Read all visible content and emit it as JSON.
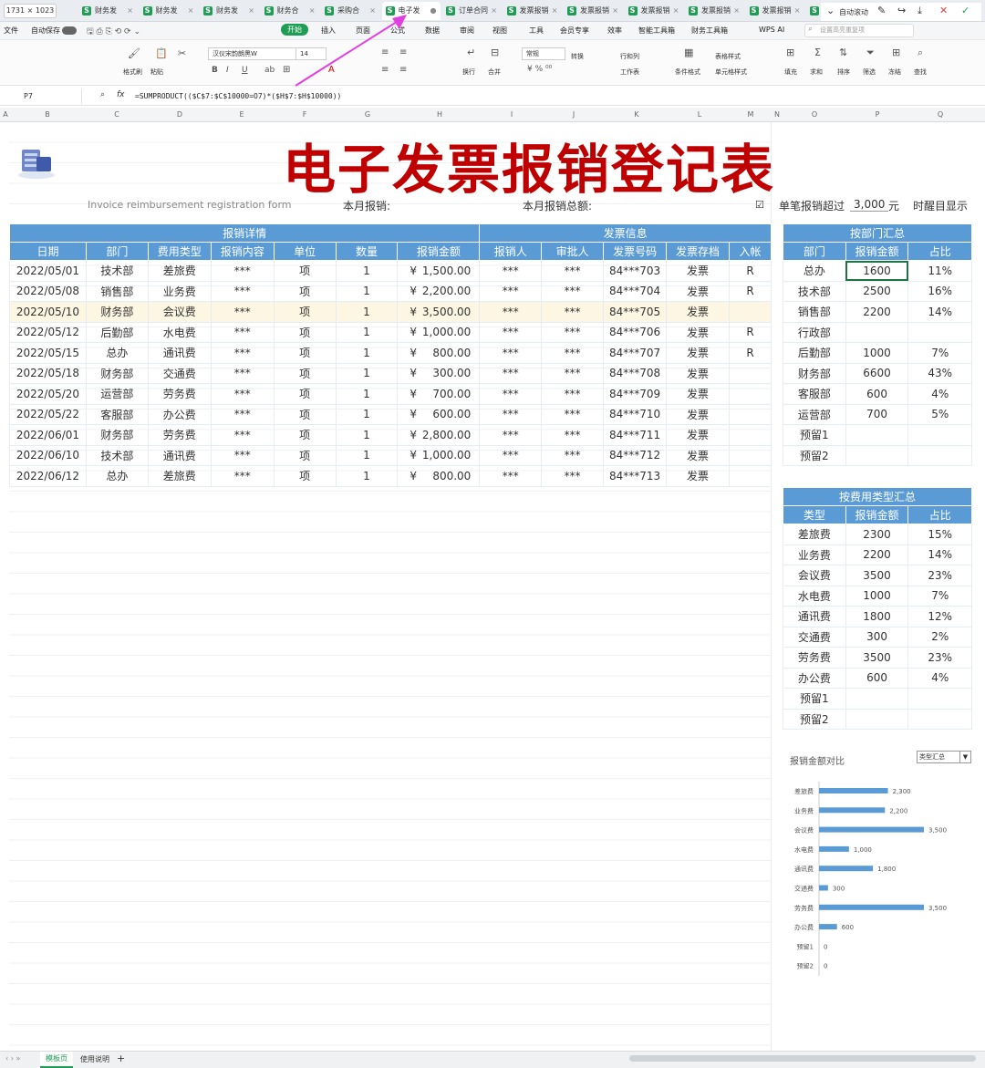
{
  "window": {
    "dimensions": "1731 × 1023",
    "auto_scroll": "自动滚动"
  },
  "tabs": [
    {
      "label": "财务发",
      "active": false
    },
    {
      "label": "财务发",
      "active": false
    },
    {
      "label": "财务发",
      "active": false
    },
    {
      "label": "财务合",
      "active": false
    },
    {
      "label": "采购合",
      "active": false
    },
    {
      "label": "电子发",
      "active": true
    },
    {
      "label": "订单合同",
      "active": false
    },
    {
      "label": "发票报销",
      "active": false
    },
    {
      "label": "发票报销",
      "active": false
    },
    {
      "label": "发票报销",
      "active": false
    },
    {
      "label": "发票报销",
      "active": false
    },
    {
      "label": "发票报销",
      "active": false
    },
    {
      "label": "2",
      "active": false
    }
  ],
  "menu": {
    "file": "文件",
    "autosave": "自动保存",
    "items": [
      "开始",
      "插入",
      "页面",
      "公式",
      "数据",
      "审阅",
      "视图",
      "工具",
      "会员专享",
      "效率",
      "智能工具箱",
      "财务工具箱",
      "WPS AI"
    ],
    "search_placeholder": "设置高亮重复项"
  },
  "ribbon": {
    "font_name": "汉仪宋韵朗黑W",
    "font_size": "14",
    "number_format": "常规",
    "labels": [
      "格式刷",
      "粘贴",
      "换行",
      "合并",
      "转换",
      "行和列",
      "工作表",
      "条件格式",
      "表格样式",
      "单元格样式",
      "填充",
      "求和",
      "排序",
      "筛选",
      "冻结",
      "查找"
    ]
  },
  "formula_bar": {
    "cell": "P7",
    "fx": "fx",
    "formula": "=SUMPRODUCT(($C$7:$C$10000=O7)*($H$7:$H$10000))"
  },
  "columns": [
    "A",
    "B",
    "C",
    "D",
    "E",
    "F",
    "G",
    "H",
    "I",
    "J",
    "K",
    "L",
    "M",
    "N",
    "O",
    "P",
    "Q"
  ],
  "sheet": {
    "title": "电子发票报销登记表",
    "subtitle_en": "Invoice  reimbursement  registration  form",
    "this_month": "本月报销:",
    "this_month_total": "本月报销总额:",
    "threshold_checkbox": "☑",
    "threshold_label": "单笔报销超过",
    "threshold_value": "3,000",
    "threshold_unit": "元",
    "reminder": "时醒目显示"
  },
  "main_table": {
    "group1": "报销详情",
    "group2": "发票信息",
    "headers": [
      "日期",
      "部门",
      "费用类型",
      "报销内容",
      "单位",
      "数量",
      "报销金额",
      "报销人",
      "审批人",
      "发票号码",
      "发票存档",
      "入帐"
    ],
    "currency": "¥",
    "rows": [
      {
        "date": "2022/05/01",
        "dept": "技术部",
        "type": "差旅费",
        "content": "***",
        "unit": "项",
        "qty": "1",
        "amount": "1,500.00",
        "person": "***",
        "approver": "***",
        "invoice": "84***703",
        "archive": "发票",
        "posted": "R"
      },
      {
        "date": "2022/05/08",
        "dept": "销售部",
        "type": "业务费",
        "content": "***",
        "unit": "项",
        "qty": "1",
        "amount": "2,200.00",
        "person": "***",
        "approver": "***",
        "invoice": "84***704",
        "archive": "发票",
        "posted": "R"
      },
      {
        "date": "2022/05/10",
        "dept": "财务部",
        "type": "会议费",
        "content": "***",
        "unit": "项",
        "qty": "1",
        "amount": "3,500.00",
        "person": "***",
        "approver": "***",
        "invoice": "84***705",
        "archive": "发票",
        "posted": ""
      },
      {
        "date": "2022/05/12",
        "dept": "后勤部",
        "type": "水电费",
        "content": "***",
        "unit": "项",
        "qty": "1",
        "amount": "1,000.00",
        "person": "***",
        "approver": "***",
        "invoice": "84***706",
        "archive": "发票",
        "posted": "R"
      },
      {
        "date": "2022/05/15",
        "dept": "总办",
        "type": "通讯费",
        "content": "***",
        "unit": "项",
        "qty": "1",
        "amount": "800.00",
        "person": "***",
        "approver": "***",
        "invoice": "84***707",
        "archive": "发票",
        "posted": "R"
      },
      {
        "date": "2022/05/18",
        "dept": "财务部",
        "type": "交通费",
        "content": "***",
        "unit": "项",
        "qty": "1",
        "amount": "300.00",
        "person": "***",
        "approver": "***",
        "invoice": "84***708",
        "archive": "发票",
        "posted": ""
      },
      {
        "date": "2022/05/20",
        "dept": "运营部",
        "type": "劳务费",
        "content": "***",
        "unit": "项",
        "qty": "1",
        "amount": "700.00",
        "person": "***",
        "approver": "***",
        "invoice": "84***709",
        "archive": "发票",
        "posted": ""
      },
      {
        "date": "2022/05/22",
        "dept": "客服部",
        "type": "办公费",
        "content": "***",
        "unit": "项",
        "qty": "1",
        "amount": "600.00",
        "person": "***",
        "approver": "***",
        "invoice": "84***710",
        "archive": "发票",
        "posted": ""
      },
      {
        "date": "2022/06/01",
        "dept": "财务部",
        "type": "劳务费",
        "content": "***",
        "unit": "项",
        "qty": "1",
        "amount": "2,800.00",
        "person": "***",
        "approver": "***",
        "invoice": "84***711",
        "archive": "发票",
        "posted": ""
      },
      {
        "date": "2022/06/10",
        "dept": "技术部",
        "type": "通讯费",
        "content": "***",
        "unit": "项",
        "qty": "1",
        "amount": "1,000.00",
        "person": "***",
        "approver": "***",
        "invoice": "84***712",
        "archive": "发票",
        "posted": ""
      },
      {
        "date": "2022/06/12",
        "dept": "总办",
        "type": "差旅费",
        "content": "***",
        "unit": "项",
        "qty": "1",
        "amount": "800.00",
        "person": "***",
        "approver": "***",
        "invoice": "84***713",
        "archive": "发票",
        "posted": ""
      }
    ],
    "highlight_row": 2
  },
  "dept_summary": {
    "title": "按部门汇总",
    "headers": [
      "部门",
      "报销金额",
      "占比"
    ],
    "rows": [
      [
        "总办",
        "1600",
        "11%"
      ],
      [
        "技术部",
        "2500",
        "16%"
      ],
      [
        "销售部",
        "2200",
        "14%"
      ],
      [
        "行政部",
        "",
        ""
      ],
      [
        "后勤部",
        "1000",
        "7%"
      ],
      [
        "财务部",
        "6600",
        "43%"
      ],
      [
        "客服部",
        "600",
        "4%"
      ],
      [
        "运营部",
        "700",
        "5%"
      ],
      [
        "预留1",
        "",
        ""
      ],
      [
        "预留2",
        "",
        ""
      ]
    ]
  },
  "type_summary": {
    "title": "按费用类型汇总",
    "headers": [
      "类型",
      "报销金额",
      "占比"
    ],
    "rows": [
      [
        "差旅费",
        "2300",
        "15%"
      ],
      [
        "业务费",
        "2200",
        "14%"
      ],
      [
        "会议费",
        "3500",
        "23%"
      ],
      [
        "水电费",
        "1000",
        "7%"
      ],
      [
        "通讯费",
        "1800",
        "12%"
      ],
      [
        "交通费",
        "300",
        "2%"
      ],
      [
        "劳务费",
        "3500",
        "23%"
      ],
      [
        "办公费",
        "600",
        "4%"
      ],
      [
        "预留1",
        "",
        ""
      ],
      [
        "预留2",
        "",
        ""
      ]
    ]
  },
  "chart_data": {
    "type": "bar",
    "orientation": "horizontal",
    "title": "报销金额对比",
    "selector": "类型汇总",
    "categories": [
      "差旅费",
      "业务费",
      "会议费",
      "水电费",
      "通讯费",
      "交通费",
      "劳务费",
      "办公费",
      "预留1",
      "预留2"
    ],
    "values": [
      2300,
      2200,
      3500,
      1000,
      1800,
      300,
      3500,
      600,
      0,
      0
    ],
    "labels": [
      "2,300",
      "2,200",
      "3,500",
      "1,000",
      "1,800",
      "300",
      "3,500",
      "600",
      "0",
      "0"
    ],
    "xlim": [
      0,
      3500
    ],
    "color": "#5b9bd5"
  },
  "sheet_tabs": [
    "模板页",
    "使用说明"
  ],
  "add_sheet": "+"
}
